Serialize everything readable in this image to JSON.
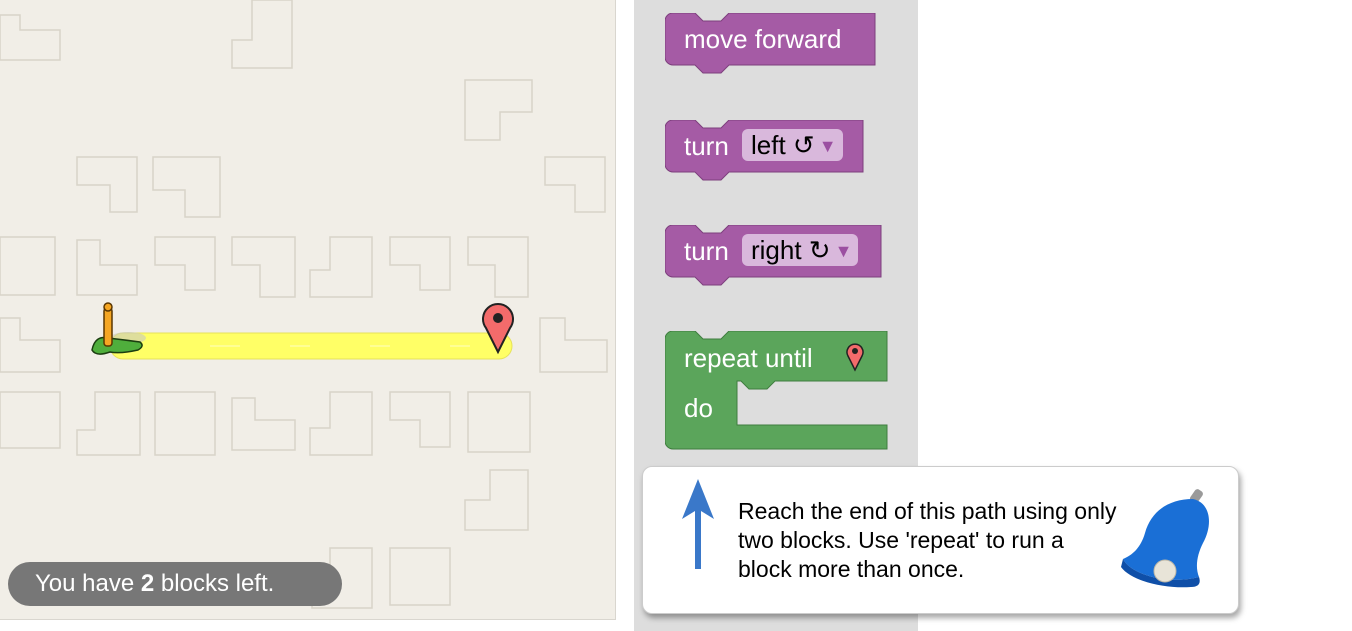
{
  "status": {
    "prefix": "You have ",
    "count": "2",
    "suffix": " blocks left."
  },
  "toolbox": {
    "move_forward": "move forward",
    "turn_left": {
      "verb": "turn",
      "option": "left ↺"
    },
    "turn_right": {
      "verb": "turn",
      "option": "right ↻"
    },
    "repeat": {
      "label": "repeat until",
      "do_label": "do"
    }
  },
  "hint": {
    "text": "Reach the end of this path using only two blocks. Use 'repeat' to run a block more than once."
  },
  "colors": {
    "motion_block": "#a55ba5",
    "loop_block": "#5ba55b",
    "path": "#ffff66",
    "maze_bg": "#f1eee7",
    "hint_arrow": "#3a78c9",
    "bell": "#1a6fd6"
  },
  "icons": {
    "start": "pegman-marker-icon",
    "goal": "goal-pin-icon",
    "hint_arrow": "arrow-up-icon",
    "hint_bell": "bell-icon",
    "dropdown": "triangle-down-icon"
  }
}
